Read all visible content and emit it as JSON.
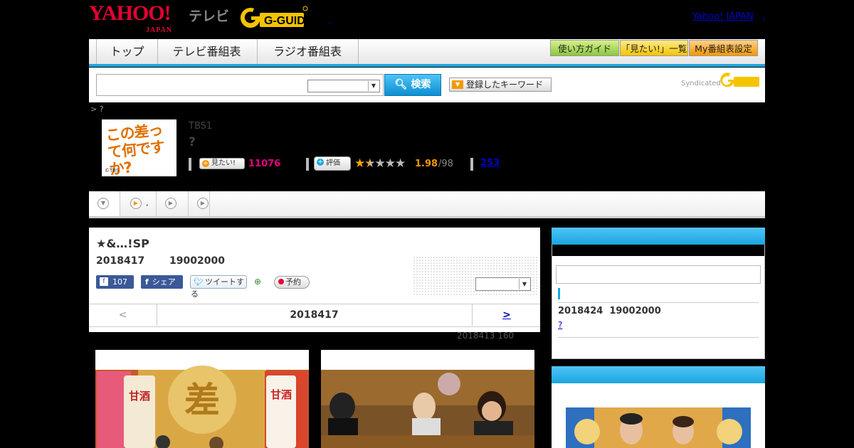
{
  "header": {
    "yahoo_logo": "YAHOO!",
    "yahoo_japan_sub": "JAPAN",
    "tv_label": "テレビ",
    "gguide_logo": "G-GUIDE",
    "header_dot": ",",
    "yahoo_japan_link": "Yahoo! JAPAN",
    "yahoo_japan_dot": ","
  },
  "nav": {
    "tabs": [
      "トップ",
      "テレビ番組表",
      "ラジオ番組表"
    ],
    "guide_buttons": [
      "使い方ガイド",
      "「見たい!」一覧",
      "My番組表設定"
    ]
  },
  "search": {
    "input_value": "",
    "select_value": "",
    "button_label": "検索",
    "keyword_button": "登録したキーワード",
    "syndicated_label": "Syndicated"
  },
  "breadcrumb": "> ?",
  "program": {
    "thumb_text": "この差って何ですか?",
    "thumb_copyright": "©TBS",
    "channel": "TBS1",
    "title": "?",
    "mitai_button": "見たい!",
    "mitai_count": "11076",
    "hyoka_button": "評価",
    "stars": "★★★★★",
    "rating": "1.98",
    "rating_count": "/98",
    "review_count": "253"
  },
  "tabs_row": {
    "tab2_label": ","
  },
  "episode": {
    "title": "★&…!SP",
    "date": "2018417",
    "time": "19002000",
    "fb_like_count": "107",
    "fb_share": "シェア",
    "tweet": "ツイートする",
    "yoyaku": "予約",
    "select_value": ""
  },
  "pager": {
    "prev": "<",
    "current": "2018417",
    "next": ">"
  },
  "footer_note": "2018413  160",
  "sidebar": {
    "next_date": "2018424",
    "next_time": "19002000",
    "next_link": "?"
  },
  "colors": {
    "accent_blue": "#1aa6e0",
    "mitai_pink": "#e4007f",
    "rating_orange": "#f39800",
    "yahoo_red": "#e60033"
  },
  "icons": [
    "search-icon",
    "play-circle-icon",
    "chevron-down-icon",
    "facebook-icon",
    "twitter-icon",
    "add-user-icon",
    "star-icon"
  ]
}
